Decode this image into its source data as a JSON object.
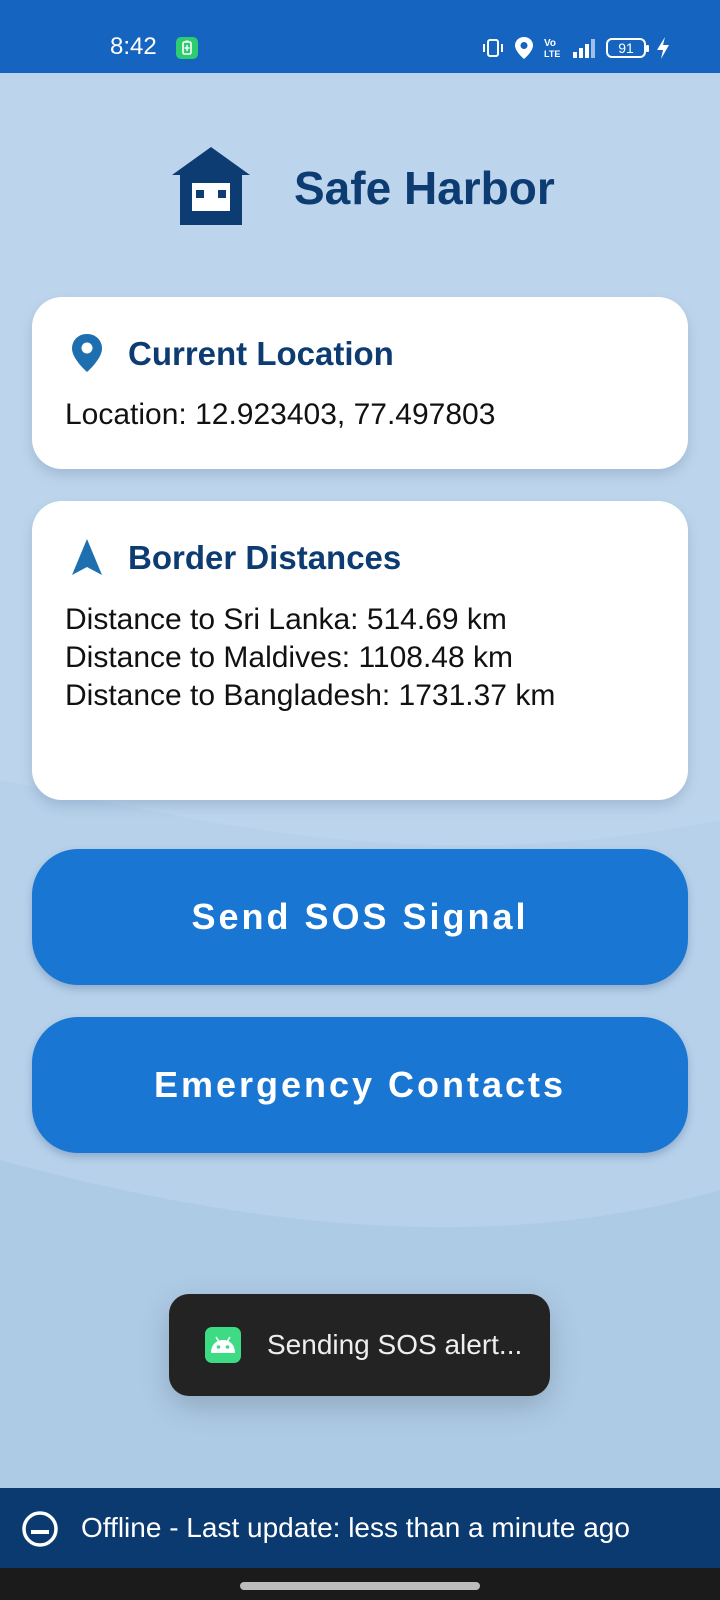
{
  "status_bar": {
    "time": "8:42",
    "battery_level": "91",
    "icons": [
      "battery-saver-icon",
      "vibrate-icon",
      "location-icon",
      "volte-icon",
      "signal-icon",
      "battery-icon",
      "charging-icon"
    ]
  },
  "header": {
    "app_title": "Safe Harbor",
    "logo_icon": "house-icon"
  },
  "location_card": {
    "title": "Current Location",
    "icon": "location-pin-icon",
    "text": "Location: 12.923403, 77.497803"
  },
  "border_card": {
    "title": "Border Distances",
    "icon": "navigation-arrow-icon",
    "distances": [
      "Distance to Sri Lanka: 514.69 km",
      "Distance to Maldives: 1108.48 km",
      "Distance to Bangladesh: 1731.37 km"
    ]
  },
  "buttons": {
    "sos_label": "Send SOS Signal",
    "contacts_label": "Emergency Contacts"
  },
  "toast": {
    "message": "Sending SOS alert...",
    "icon": "android-icon"
  },
  "offline_bar": {
    "text": "Offline - Last update: less than a minute ago",
    "icon": "offline-icon"
  },
  "colors": {
    "status_bar": "#1565c0",
    "background": "#bdd5ec",
    "title": "#0d3c73",
    "button": "#1976d2",
    "offline_bar": "#0b3a70",
    "toast": "#232323"
  }
}
